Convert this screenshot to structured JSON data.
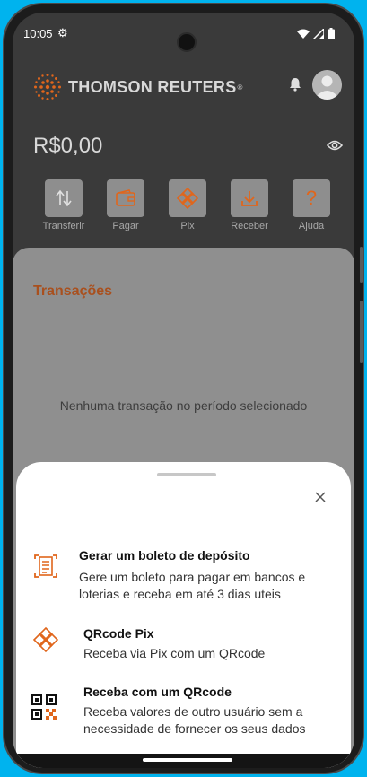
{
  "status": {
    "time": "10:05"
  },
  "header": {
    "logo_text": "THOMSON REUTERS",
    "logo_mark": "®"
  },
  "balance": {
    "amount": "R$0,00"
  },
  "actions": [
    {
      "label": "Transferir",
      "icon": "transfer-arrows-icon"
    },
    {
      "label": "Pagar",
      "icon": "wallet-icon"
    },
    {
      "label": "Pix",
      "icon": "pix-icon"
    },
    {
      "label": "Receber",
      "icon": "download-icon"
    },
    {
      "label": "Ajuda",
      "icon": "question-icon"
    }
  ],
  "transactions": {
    "title": "Transações",
    "empty_message": "Nenhuma transação no período selecionado"
  },
  "sheet": {
    "options": [
      {
        "title": "Gerar um boleto de depósito",
        "description": "Gere um boleto para pagar em bancos e loterias e receba em até 3 dias uteis",
        "icon": "barcode-document-icon"
      },
      {
        "title": "QRcode Pix",
        "description": "Receba via Pix com um QRcode",
        "icon": "pix-icon"
      },
      {
        "title": "Receba com um QRcode",
        "description": "Receba valores de outro usuário sem a necessidade de fornecer os seus dados",
        "icon": "qrcode-icon"
      }
    ]
  },
  "colors": {
    "accent": "#e0661c",
    "title_accent": "#a9501e",
    "frame": "#00b3ee"
  }
}
